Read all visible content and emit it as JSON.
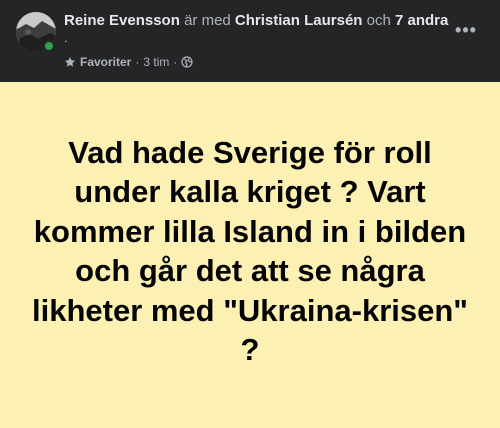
{
  "post": {
    "author": "Reine Evensson",
    "with_text": "är med",
    "tagged": "Christian Laursén",
    "and_text": "och",
    "others": "7 andra",
    "dot": ".",
    "audience": "Favoriter",
    "separator1": "·",
    "time": "3 tim",
    "separator2": "·",
    "more": "•••",
    "body_text": "Vad hade Sverige för roll under kalla kriget ? Vart kommer lilla Island in i bilden och går det att se några likheter med \"Ukraina-krisen\" ?"
  },
  "icons": {
    "favorite": "star-icon",
    "privacy": "globe-icon",
    "online": "online-status-icon"
  },
  "colors": {
    "header_bg": "#242526",
    "body_bg": "#fcf1b3",
    "online": "#31a24c"
  }
}
